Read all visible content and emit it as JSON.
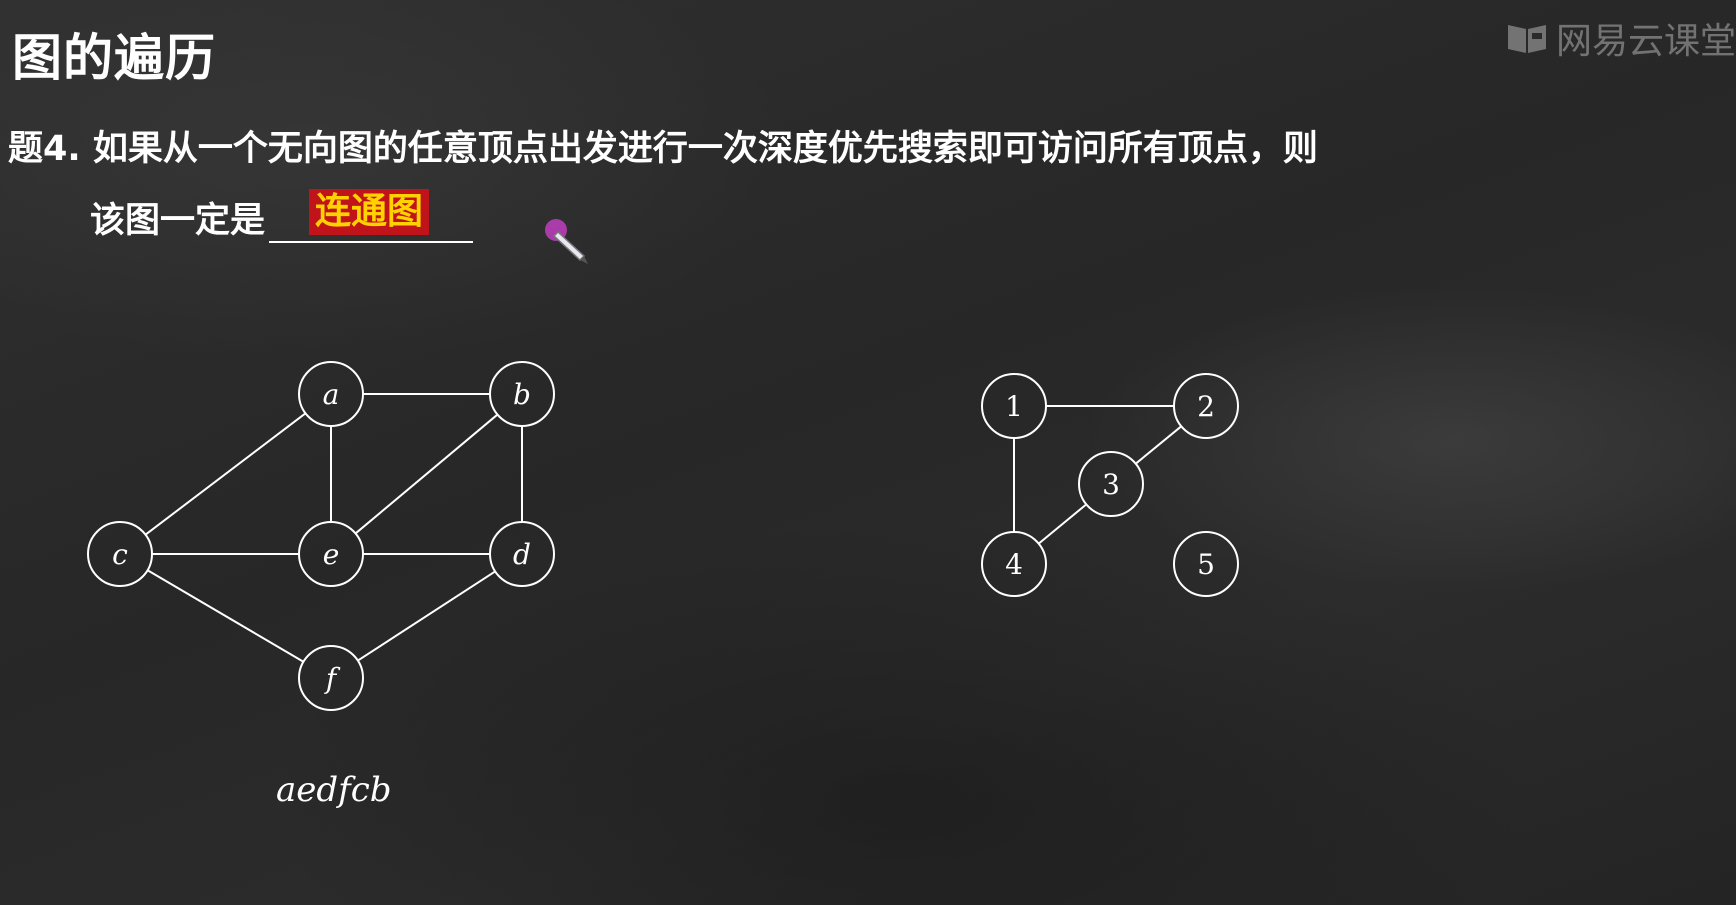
{
  "header": {
    "title": "图的遍历",
    "watermark": "网易云课堂"
  },
  "question": {
    "line1": "题4. 如果从一个无向图的任意顶点出发进行一次深度优先搜索即可访问所有顶点，则",
    "line2_prefix": "该图一定是",
    "answer": "连通图"
  },
  "graph_left": {
    "nodes": [
      {
        "id": "a",
        "label": "a"
      },
      {
        "id": "b",
        "label": "b"
      },
      {
        "id": "c",
        "label": "c"
      },
      {
        "id": "e",
        "label": "e"
      },
      {
        "id": "d",
        "label": "d"
      },
      {
        "id": "f",
        "label": "f"
      }
    ],
    "edges": [
      [
        "a",
        "b"
      ],
      [
        "a",
        "c"
      ],
      [
        "a",
        "e"
      ],
      [
        "b",
        "e"
      ],
      [
        "b",
        "d"
      ],
      [
        "c",
        "e"
      ],
      [
        "e",
        "d"
      ],
      [
        "c",
        "f"
      ],
      [
        "d",
        "f"
      ]
    ],
    "traversal": "aedfcb"
  },
  "graph_right": {
    "nodes": [
      {
        "id": "1",
        "label": "1"
      },
      {
        "id": "2",
        "label": "2"
      },
      {
        "id": "3",
        "label": "3"
      },
      {
        "id": "4",
        "label": "4"
      },
      {
        "id": "5",
        "label": "5"
      }
    ],
    "edges": [
      [
        "1",
        "2"
      ],
      [
        "2",
        "3"
      ],
      [
        "3",
        "4"
      ],
      [
        "1",
        "4"
      ]
    ]
  },
  "colors": {
    "answer_bg": "#c0141a",
    "answer_text": "#ffd200",
    "chalk": "#ffffff",
    "cursor_dot": "#c040c0"
  }
}
